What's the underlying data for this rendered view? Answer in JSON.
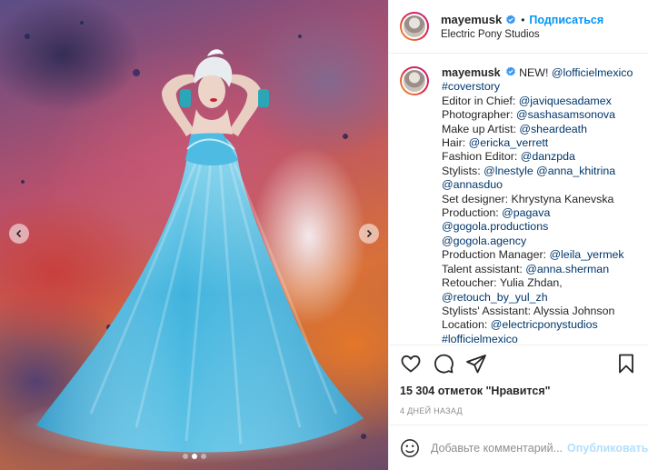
{
  "post": {
    "username": "mayemusk",
    "follow_label": "Подписаться",
    "separator": "•",
    "location": "Electric Pony Studios",
    "carousel": {
      "total_slides": 3,
      "active_slide": 2
    }
  },
  "caption": {
    "username": "mayemusk",
    "lines": [
      {
        "text": "NEW! ",
        "link": "@lofficielmexico"
      },
      {
        "text": "",
        "link": "#coverstory"
      },
      {
        "text": "Editor in Chief: ",
        "link": "@javiquesadamex"
      },
      {
        "text": "Photographer: ",
        "link": "@sashasamsonova"
      },
      {
        "text": "Make up Artist: ",
        "link": "@sheardeath"
      },
      {
        "text": "Hair: ",
        "link": "@ericka_verrett"
      },
      {
        "text": "Fashion Editor: ",
        "link": "@danzpda"
      },
      {
        "text": "Stylists: ",
        "link": "@lnestyle @anna_khitrina"
      },
      {
        "text": "",
        "link": "@annasduo"
      },
      {
        "text": "Set designer: Khrystyna Kanevska",
        "link": ""
      },
      {
        "text": "Production: ",
        "link": "@pagava"
      },
      {
        "text": "",
        "link": "@gogola.productions"
      },
      {
        "text": "",
        "link": "@gogola.agency"
      },
      {
        "text": "Production Manager: ",
        "link": "@leila_yermek"
      },
      {
        "text": "Talent assistant: ",
        "link": "@anna.sherman"
      },
      {
        "text": "Retoucher: Yulia Zhdan,",
        "link": ""
      },
      {
        "text": "",
        "link": "@retouch_by_yul_zh"
      },
      {
        "text": "Stylists' Assistant: Alyssia Johnson",
        "link": ""
      },
      {
        "text": "Location: ",
        "link": "@electricponystudios"
      },
      {
        "text": "",
        "link": "#lofficielmexico"
      }
    ]
  },
  "stats": {
    "likes": "15 304 отметок \"Нравится\"",
    "time": "4 ДНЕЙ НАЗАД"
  },
  "comment_box": {
    "placeholder": "Добавьте комментарий...",
    "publish_label": "Опубликовать"
  },
  "icons": {
    "like": "heart-icon",
    "comment": "comment-icon",
    "share": "share-icon",
    "save": "bookmark-icon",
    "emoji": "emoji-icon",
    "verified": "verified-badge-icon",
    "prev": "chevron-left-icon",
    "next": "chevron-right-icon"
  },
  "colors": {
    "link": "#00376b",
    "follow": "#0095f6",
    "publish_disabled": "#b2dffc",
    "verified": "#3897f0"
  }
}
